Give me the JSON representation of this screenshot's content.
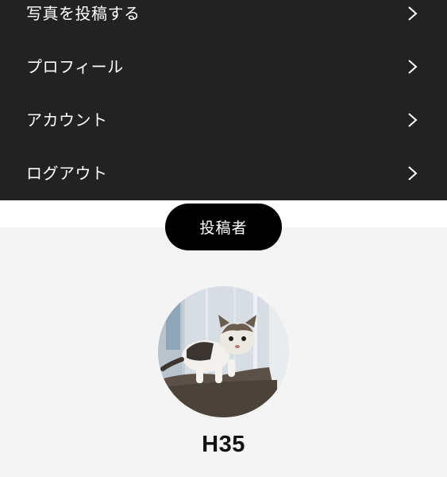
{
  "menu": {
    "items": [
      {
        "label": "写真を投稿する",
        "icon": "chevron-right-icon"
      },
      {
        "label": "プロフィール",
        "icon": "chevron-right-icon"
      },
      {
        "label": "アカウント",
        "icon": "chevron-right-icon"
      },
      {
        "label": "ログアウト",
        "icon": "chevron-right-icon"
      }
    ]
  },
  "profile": {
    "section_label": "投稿者",
    "username": "H35",
    "avatar_subject": "kitten on sofa"
  },
  "colors": {
    "menu_background": "#222222",
    "menu_text": "#ffffff",
    "page_background": "#f4f4f4",
    "pill_background": "#000000"
  }
}
